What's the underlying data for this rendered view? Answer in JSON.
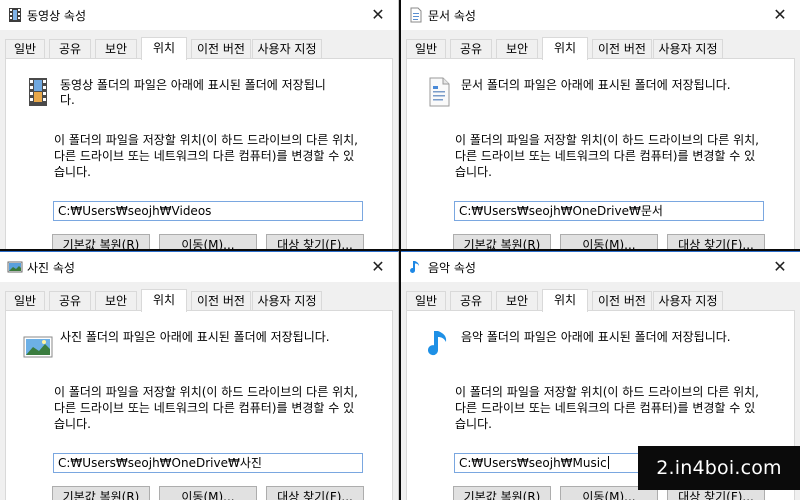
{
  "tabs": [
    "일반",
    "공유",
    "보안",
    "위치",
    "이전 버전",
    "사용자 지정"
  ],
  "info_line1": "이 폴더의 파일을 저장할 위치(이 하드 드라이브의 다른 위치,",
  "info_line2": "다른 드라이브 또는 네트워크의 다른 컴퓨터)를 변경할 수 있",
  "info_line3": "습니다.",
  "buttons": {
    "restore": "기본값 복원(R)",
    "move": "이동(M)...",
    "find_target": "대상 찾기(F)..."
  },
  "close_glyph": "✕",
  "dialogs": {
    "videos": {
      "title": "동영상 속성",
      "desc_line1": "동영상 폴더의 파일은 아래에 표시된 폴더에 저장됩니",
      "desc_line2": "다.",
      "path": "C:₩Users₩seojh₩Videos",
      "icon": "film-icon"
    },
    "documents": {
      "title": "문서 속성",
      "desc_line1": "문서 폴더의 파일은 아래에 표시된 폴더에 저장됩니다.",
      "path": "C:₩Users₩seojh₩OneDrive₩문서",
      "icon": "document-icon"
    },
    "pictures": {
      "title": "사진 속성",
      "desc_line1": "사진 폴더의 파일은 아래에 표시된 폴더에 저장됩니다.",
      "path": "C:₩Users₩seojh₩OneDrive₩사진",
      "icon": "picture-icon"
    },
    "music": {
      "title": "음악 속성",
      "desc_line1": "음악 폴더의 파일은 아래에 표시된 폴더에 저장됩니다.",
      "path": "C:₩Users₩seojh₩Music",
      "icon": "music-note-icon"
    }
  },
  "watermark": "2.in4boi.com",
  "colors": {
    "accent": "#1e73e8",
    "path_border": "#7aa7e0",
    "button_bg": "#e1e1e1",
    "tab_border": "#d9d9d9"
  }
}
